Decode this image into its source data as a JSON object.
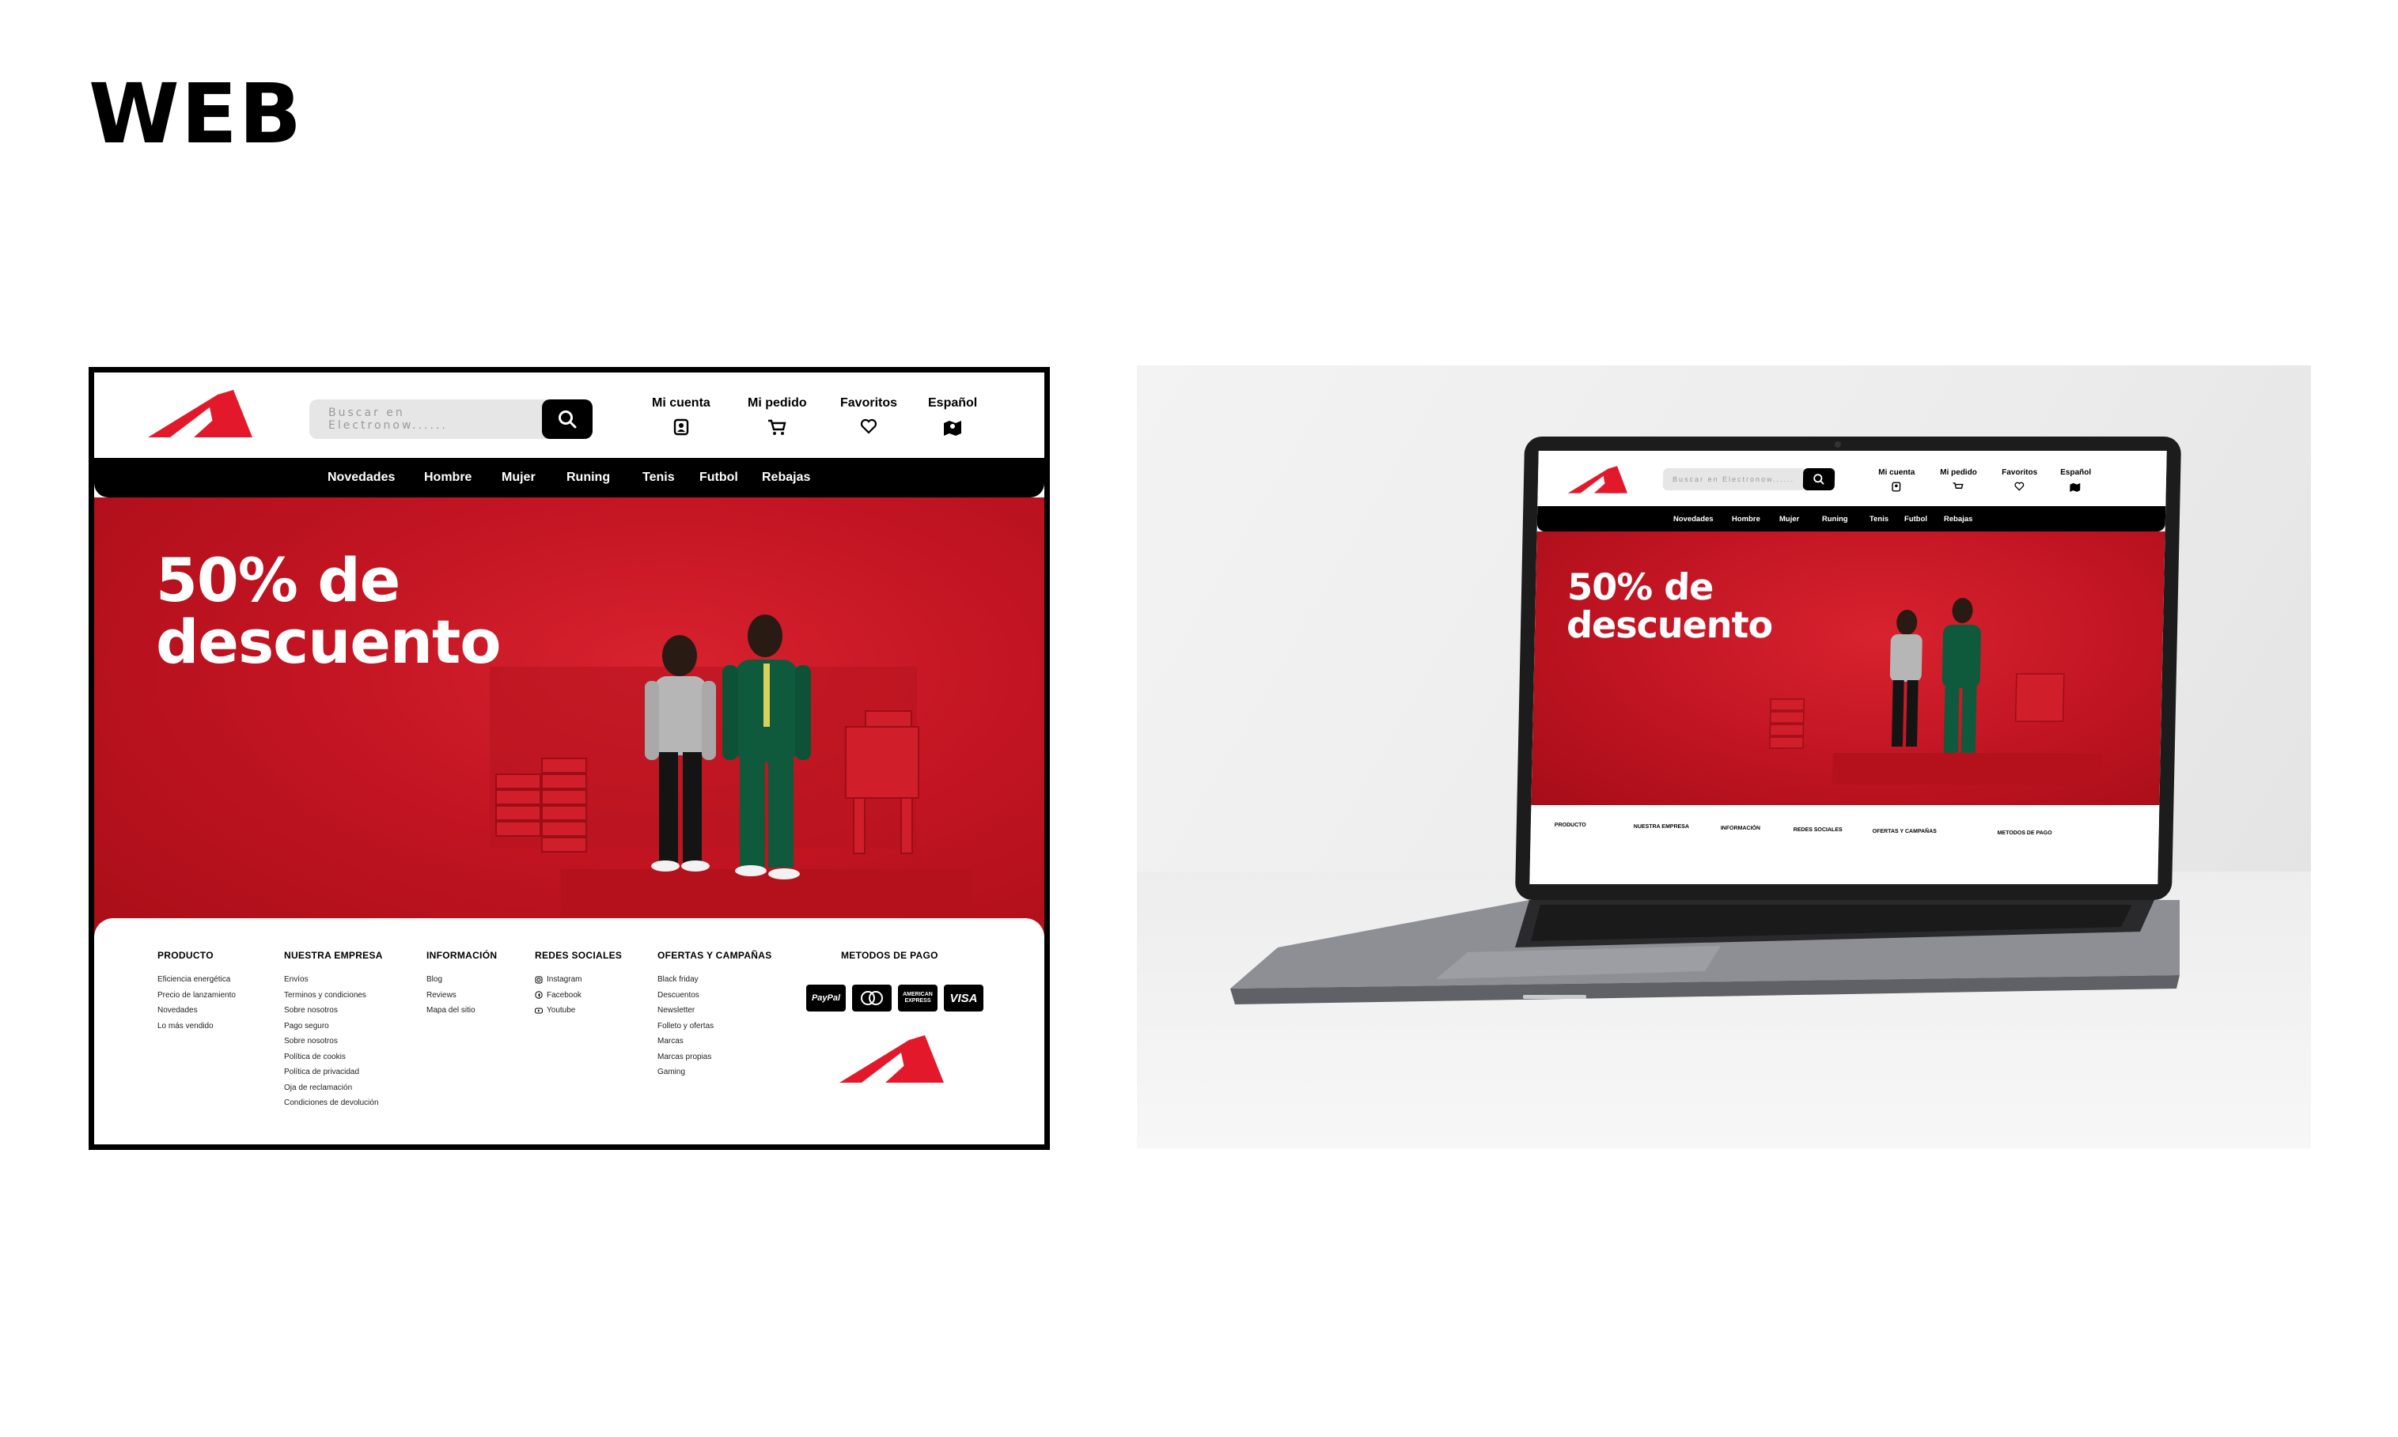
{
  "page_title": "WEB",
  "colors": {
    "brand_red": "#e3192b",
    "hero_red": "#c41623",
    "nav_black": "#000000"
  },
  "site": {
    "search": {
      "placeholder": "Buscar en Electronow......"
    },
    "header_items": [
      {
        "label": "Mi cuenta",
        "icon": "account-icon"
      },
      {
        "label": "Mi pedido",
        "icon": "cart-icon"
      },
      {
        "label": "Favoritos",
        "icon": "heart-icon"
      },
      {
        "label": "Español",
        "icon": "map-icon"
      }
    ],
    "nav": [
      "Novedades",
      "Hombre",
      "Mujer",
      "Runing",
      "Tenis",
      "Futbol",
      "Rebajas"
    ],
    "hero": {
      "line1": "50% de",
      "line2": "descuento"
    },
    "footer": {
      "columns": [
        {
          "title": "PRODUCTO",
          "items": [
            "Eficiencia energética",
            "Precio de lanzamiento",
            "Novedades",
            "Lo más vendido"
          ]
        },
        {
          "title": "NUESTRA EMPRESA",
          "items": [
            "Envíos",
            "Terminos y condiciones",
            "Sobre nosotros",
            "Pago seguro",
            "Sobre nosotros",
            "Política de cookis",
            "Política de privacidad",
            "Oja de reclamación",
            "Condiciones de devolución"
          ]
        },
        {
          "title": "INFORMACIÓN",
          "items": [
            "Blog",
            "Reviews",
            "Mapa del sitio"
          ]
        },
        {
          "title": "REDES SOCIALES",
          "items": [
            "Instagram",
            "Facebook",
            "Youtube"
          ]
        },
        {
          "title": "OFERTAS Y CAMPAÑAS",
          "items": [
            "Black friday",
            "Descuentos",
            "Newsletter",
            "Folleto y ofertas",
            "Marcas",
            "Marcas propias",
            "Gaming"
          ]
        }
      ],
      "payment_title": "METODOS DE PAGO",
      "cards": [
        "PayPal",
        "Mastercard",
        "AMERICAN EXPRESS",
        "VISA"
      ]
    }
  }
}
